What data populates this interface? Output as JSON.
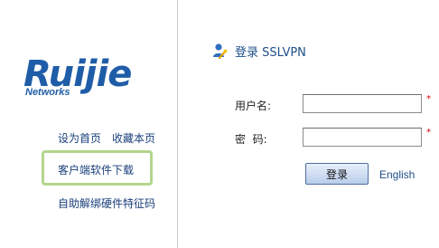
{
  "brand": {
    "logo_word": "Ruijie",
    "logo_sub": "Networks"
  },
  "left_links": {
    "set_home": "设为首页",
    "bookmark": "收藏本页",
    "client_download": "客户端软件下载",
    "unbind_hardware": "自助解绑硬件特征码"
  },
  "login": {
    "title": "登录 SSLVPN",
    "username_label": "用户名:",
    "password_label": "密  码:",
    "username_value": "",
    "password_value": "",
    "required_mark": "*",
    "submit_label": "登录",
    "language_link": "English"
  },
  "colors": {
    "brand_blue": "#1f5da8",
    "link_blue": "#1a3f7a",
    "highlight_green": "#b4d58d",
    "required_red": "#d20000"
  },
  "icons": {
    "title_icon": "user-key-icon"
  }
}
